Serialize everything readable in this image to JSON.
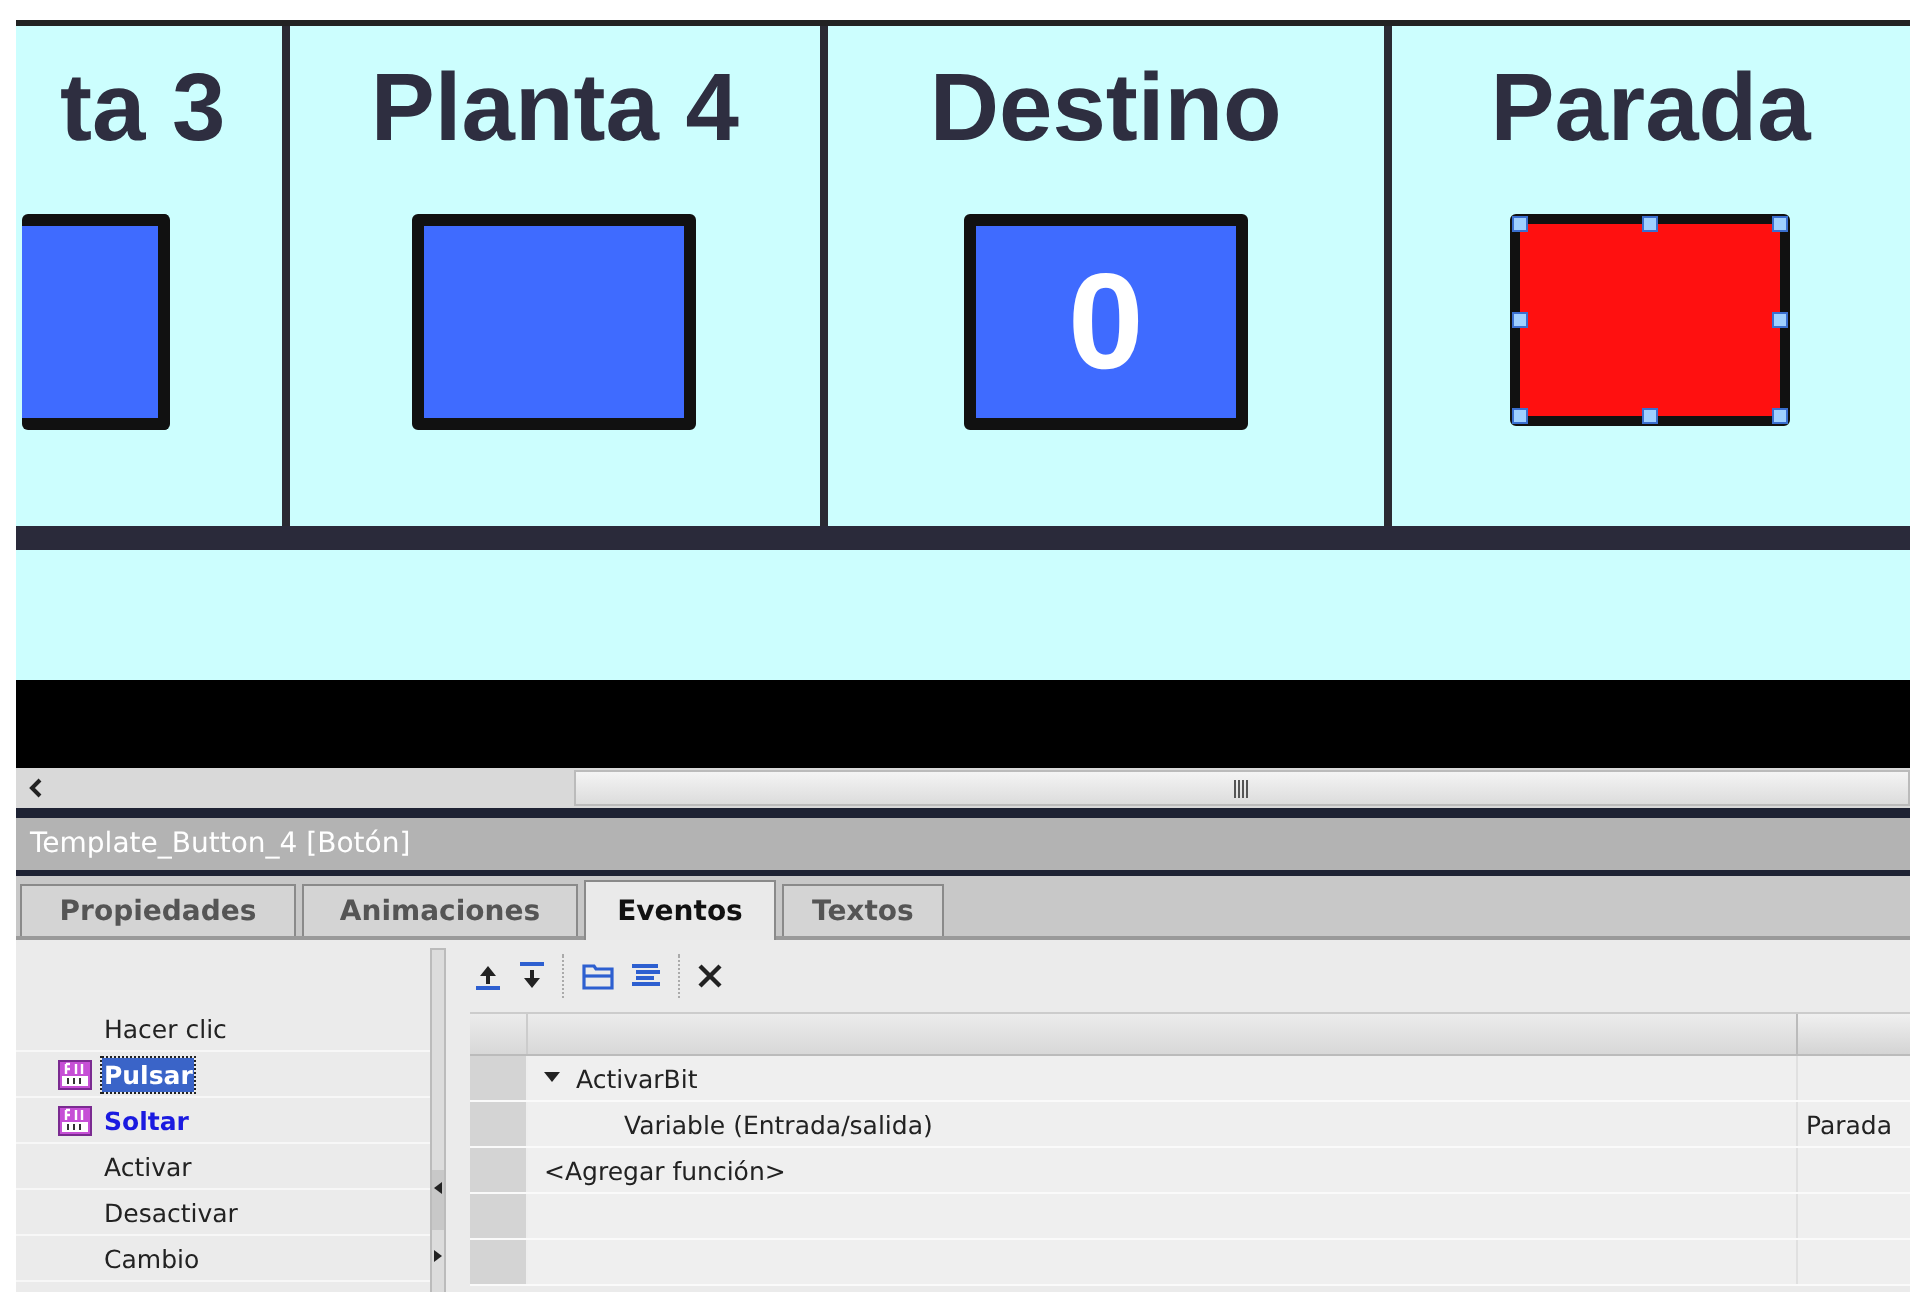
{
  "screen": {
    "tiles": [
      {
        "label": "ta 3",
        "color": "#3f6bff",
        "selected": false
      },
      {
        "label": "Planta 4",
        "color": "#3f6bff",
        "selected": false
      },
      {
        "label": "Destino",
        "color": "#3f6bff",
        "value": "0",
        "selected": false
      },
      {
        "label": "Parada",
        "color": "#ff1010",
        "selected": true
      }
    ]
  },
  "inspector": {
    "title": "Template_Button_4 [Botón]",
    "tabs": [
      {
        "label": "Propiedades",
        "selected": false
      },
      {
        "label": "Animaciones",
        "selected": false
      },
      {
        "label": "Eventos",
        "selected": true
      },
      {
        "label": "Textos",
        "selected": false
      }
    ],
    "events": [
      {
        "label": "Hacer clic",
        "has_function": false,
        "selected": false
      },
      {
        "label": "Pulsar",
        "has_function": true,
        "selected": true
      },
      {
        "label": "Soltar",
        "has_function": true,
        "selected": false
      },
      {
        "label": "Activar",
        "has_function": false,
        "selected": false
      },
      {
        "label": "Desactivar",
        "has_function": false,
        "selected": false
      },
      {
        "label": "Cambio",
        "has_function": false,
        "selected": false
      }
    ],
    "rows": [
      {
        "kind": "function",
        "text": "ActivarBit",
        "expanded": true
      },
      {
        "kind": "param",
        "text": "Variable (Entrada/salida)",
        "value": "Parada"
      },
      {
        "kind": "add",
        "text": "<Agregar función>"
      }
    ]
  }
}
